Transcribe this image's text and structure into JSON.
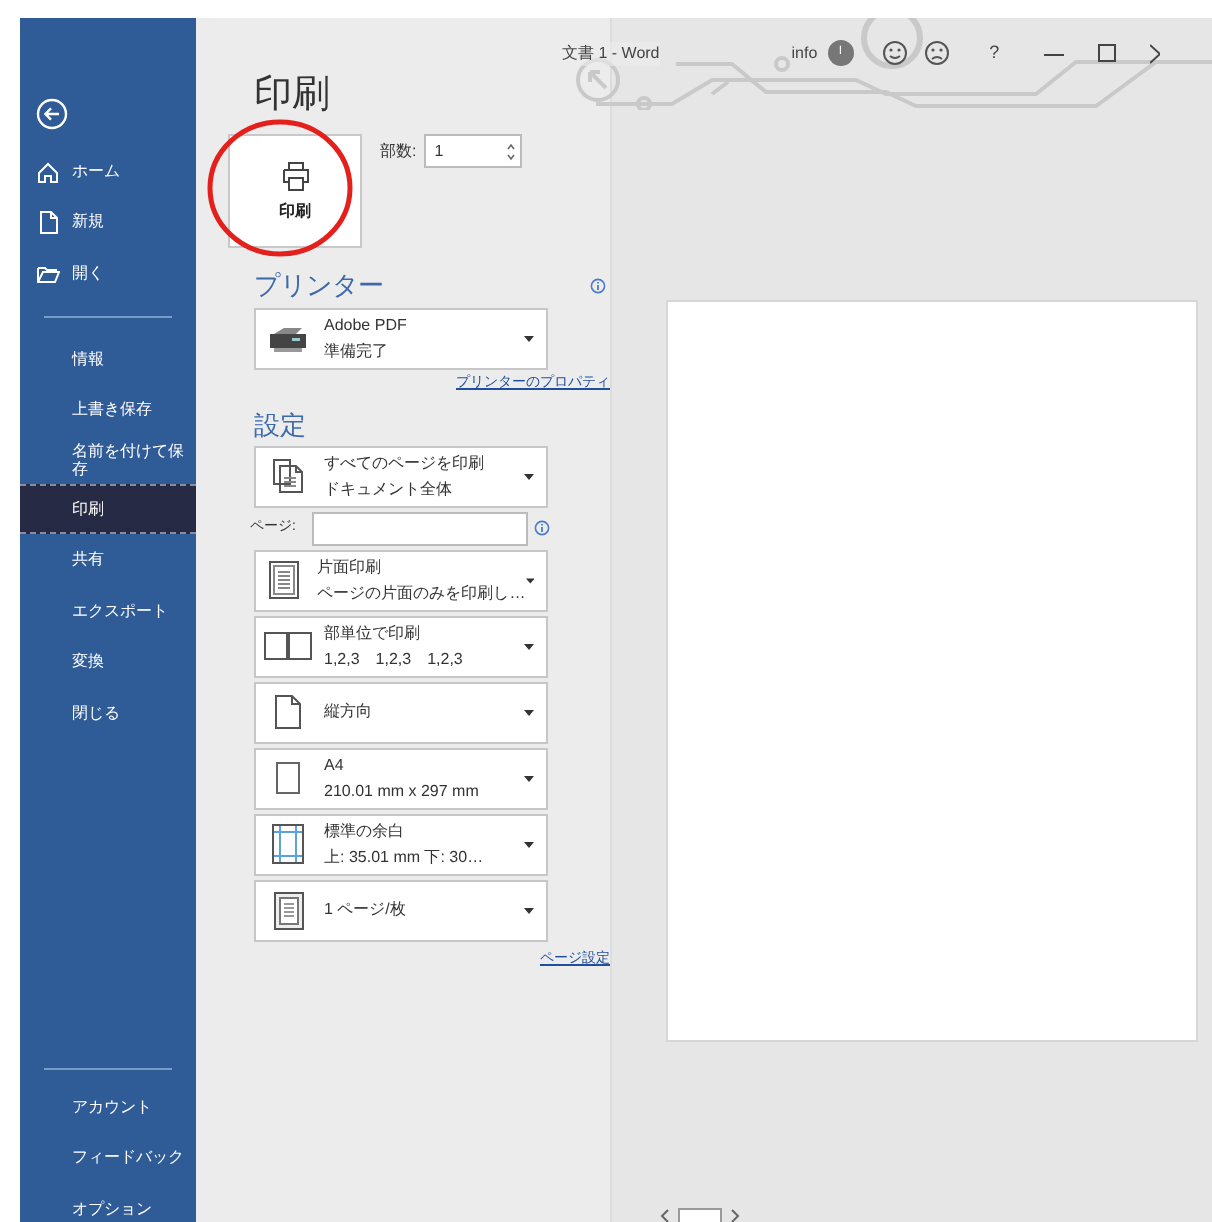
{
  "window": {
    "title": "文書 1 - Word",
    "info_label": "info",
    "avatar": "I",
    "help": "?"
  },
  "sidebar": {
    "top_items": [
      {
        "label": "ホーム",
        "kind": "home",
        "selected": false
      },
      {
        "label": "新規",
        "kind": "new",
        "selected": false
      },
      {
        "label": "開く",
        "kind": "open",
        "selected": false
      }
    ],
    "items": [
      {
        "label": "情報",
        "selected": false
      },
      {
        "label": "上書き保存",
        "selected": false
      },
      {
        "label": "名前を付けて保存",
        "selected": false
      },
      {
        "label": "印刷",
        "selected": true
      },
      {
        "label": "共有",
        "selected": false
      },
      {
        "label": "エクスポート",
        "selected": false
      },
      {
        "label": "変換",
        "selected": false
      },
      {
        "label": "閉じる",
        "selected": false
      }
    ],
    "bottom_items": [
      {
        "label": "アカウント",
        "selected": false
      },
      {
        "label": "フィードバック",
        "selected": false
      },
      {
        "label": "オプション",
        "selected": false
      }
    ]
  },
  "print": {
    "title": "印刷",
    "button": "印刷",
    "copies_label": "部数:",
    "copies": "1"
  },
  "printer": {
    "heading": "プリンター",
    "name": "Adobe PDF",
    "status": "準備完了",
    "properties_link": "プリンターのプロパティ"
  },
  "settings": {
    "heading": "設定",
    "pages_label": "ページ:",
    "page_setup_link": "ページ設定",
    "options": [
      {
        "kind": "pages",
        "line1": "すべてのページを印刷",
        "line2": "ドキュメント全体"
      },
      {
        "kind": "sides",
        "line1": "片面印刷",
        "line2": "ページの片面のみを印刷し…"
      },
      {
        "kind": "collate",
        "line1": "部単位で印刷",
        "line2": "1,2,3　1,2,3　1,2,3"
      },
      {
        "kind": "orientation",
        "line1": "縦方向"
      },
      {
        "kind": "paper",
        "line1": "A4",
        "line2": "210.01 mm x 297 mm"
      },
      {
        "kind": "margins",
        "line1": "標準の余白",
        "line2": "上: 35.01 mm 下: 30…"
      },
      {
        "kind": "persheet",
        "line1": "1 ページ/枚"
      }
    ]
  }
}
